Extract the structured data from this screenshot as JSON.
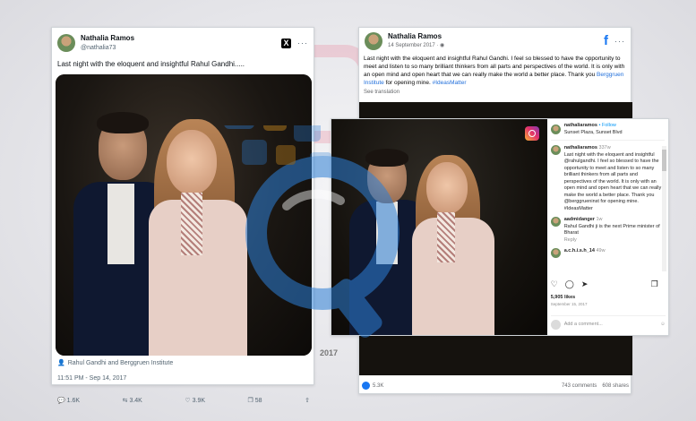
{
  "twitter": {
    "name": "Nathalia Ramos",
    "handle": "@nathalia73",
    "logo": "X",
    "menu": "···",
    "text": "Last night with the eloquent and insightful Rahul Gandhi.....",
    "location": "Rahul Gandhi and Berggruen Institute",
    "timestamp": "11:51 PM - Sep 14, 2017",
    "actions": {
      "replies": "1.6K",
      "retweets": "3.4K",
      "likes": "3.9K",
      "bookmarks": "58"
    }
  },
  "facebook": {
    "name": "Nathalia Ramos",
    "date": "14 September 2017 · ◉",
    "logo": "f",
    "menu": "···",
    "text": "Last night with the eloquent and insightful Rahul Gandhi. I feel so blessed to have the opportunity to meet and listen to so many brilliant thinkers from all parts and perspectives of the world. It is only with an open mind and open heart that we can really make the world a better place. Thank you ",
    "link": "Berggruen Institute",
    "text_end": " for opening mine. ",
    "hashtag": "#IdeasMatter",
    "translate": "See translation",
    "reactions": "5.3K",
    "comments": "743 comments",
    "shares": "608 shares"
  },
  "instagram": {
    "username": "nathaliaramos",
    "follow": "• Follow",
    "location": "Sunset Plaza, Sunset Blvd",
    "post_user": "nathaliaramos",
    "post_age": "337w",
    "caption": "Last night with the eloquent and insightful @rahulgandhi. I feel so blessed to have the opportunity to meet and listen to so many brilliant thinkers from all parts and perspectives of the world. It is only with an open mind and open heart that we can really make the world a better place. Thank you @berggrueninst for opening mine. #IdeasMatter",
    "comment_user": "aadmidanger",
    "comment_age": "1w",
    "comment_text": "Rahul Gandhi ji is the next Prime minister of Bharat",
    "reply": "Reply",
    "third_user": "a.c.h.i.s.h_14",
    "third_age": "49w",
    "likes": "5,905 likes",
    "date": "September 15, 2017",
    "comment_placeholder": "Add a comment..."
  },
  "overlay_year": "2017",
  "colors": {
    "x_black": "#000000",
    "facebook_blue": "#1877f2",
    "instagram_link": "#0095f6",
    "watermark_blue": "#2d7fd6"
  }
}
